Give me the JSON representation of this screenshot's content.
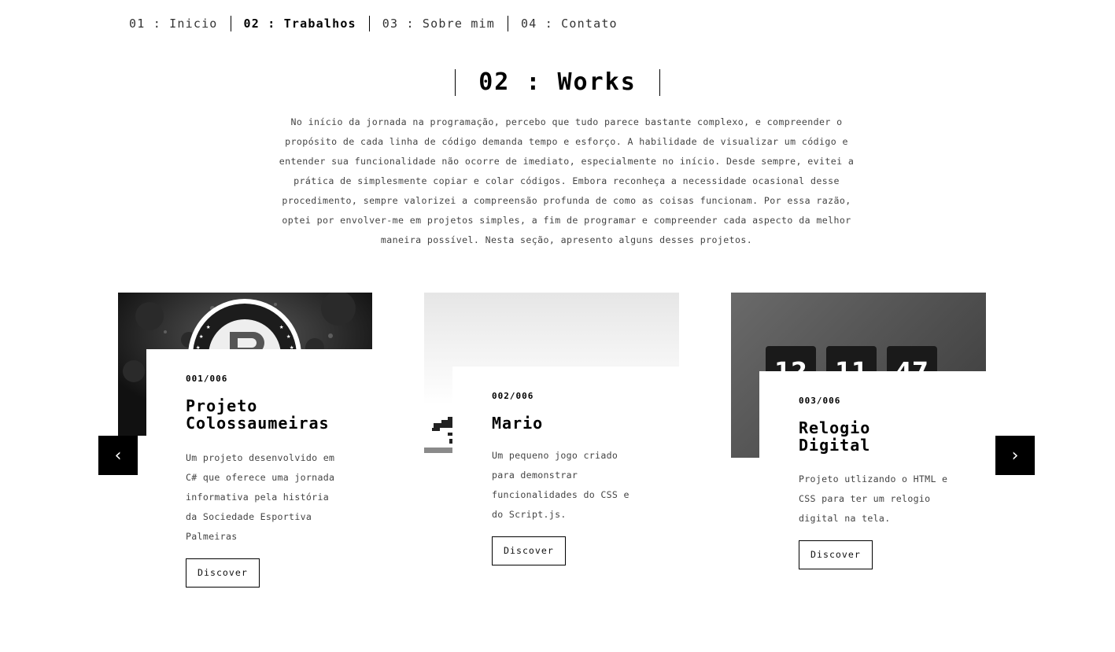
{
  "nav": {
    "items": [
      {
        "label": "01 : Inicio",
        "active": false
      },
      {
        "label": "02 : Trabalhos",
        "active": true
      },
      {
        "label": "03 : Sobre mim",
        "active": false
      },
      {
        "label": "04 : Contato",
        "active": false
      }
    ]
  },
  "section": {
    "title": "02 : Works",
    "intro": "No início da jornada na programação, percebo que tudo parece bastante complexo, e compreender o propósito de cada linha de código demanda tempo e esforço. A habilidade de visualizar um código e entender sua funcionalidade não ocorre de imediato, especialmente no início. Desde sempre, evitei a prática de simplesmente copiar e colar códigos. Embora reconheça a necessidade ocasional desse procedimento, sempre valorizei a compreensão profunda de como as coisas funcionam. Por essa razão, optei por envolver-me em projetos simples, a fim de programar e compreender cada aspecto da melhor maneira possível. Nesta seção, apresento alguns desses projetos."
  },
  "projects": [
    {
      "number": "001/006",
      "title": "Projeto\nColossaumeiras",
      "description": "Um projeto desenvolvido em C# que oferece uma jornada informativa pela história da Sociedade Esportiva Palmeiras",
      "button": "Discover",
      "image_icon": "palmeiras-crest-icon"
    },
    {
      "number": "002/006",
      "title": "Mario",
      "description": "Um pequeno jogo criado para demonstrar funcionalidades do CSS e do Script.js.",
      "button": "Discover",
      "image_icon": "mario-pipe-icon"
    },
    {
      "number": "003/006",
      "title": "Relogio\nDigital",
      "description": "Projeto utlizando o HTML e CSS para ter um relogio digital na tela.",
      "button": "Discover",
      "image_icon": "digital-clock-icon",
      "clock_digits": [
        "12",
        "11",
        "47"
      ]
    }
  ],
  "carousel": {
    "prev_icon": "‹",
    "next_icon": "›"
  }
}
